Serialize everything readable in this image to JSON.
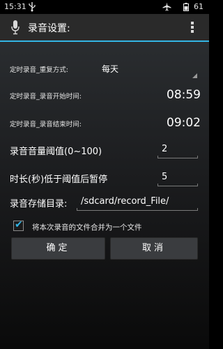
{
  "status_bar": {
    "time": "15:31",
    "battery": "61",
    "icons": [
      "usb-icon",
      "airplane-mode-icon",
      "battery-icon"
    ]
  },
  "action_bar": {
    "title": "录音设置:",
    "icons": [
      "microphone-icon",
      "overflow-menu-icon"
    ]
  },
  "settings": {
    "repeat_label": "定时录音_重复方式:",
    "repeat_value": "每天",
    "start_label": "定时录音_录音开始时间:",
    "start_value": "08:59",
    "end_label": "定时录音_录音结束时间:",
    "end_value": "09:02",
    "threshold_label": "录音音量阈值(0~100)",
    "threshold_value": "2",
    "duration_label": "时长(秒)低于阈值后暂停",
    "duration_value": "5",
    "dir_label": "录音存储目录:",
    "dir_value": "/sdcard/record_File/",
    "merge_label": "将本次录音的文件合并为一个文件",
    "merge_checked": true
  },
  "buttons": {
    "ok": "确定",
    "cancel": "取消"
  },
  "colors": {
    "accent": "#33b5e5",
    "action_bar": "#2a2a2a",
    "button": "#3a3c3f"
  }
}
